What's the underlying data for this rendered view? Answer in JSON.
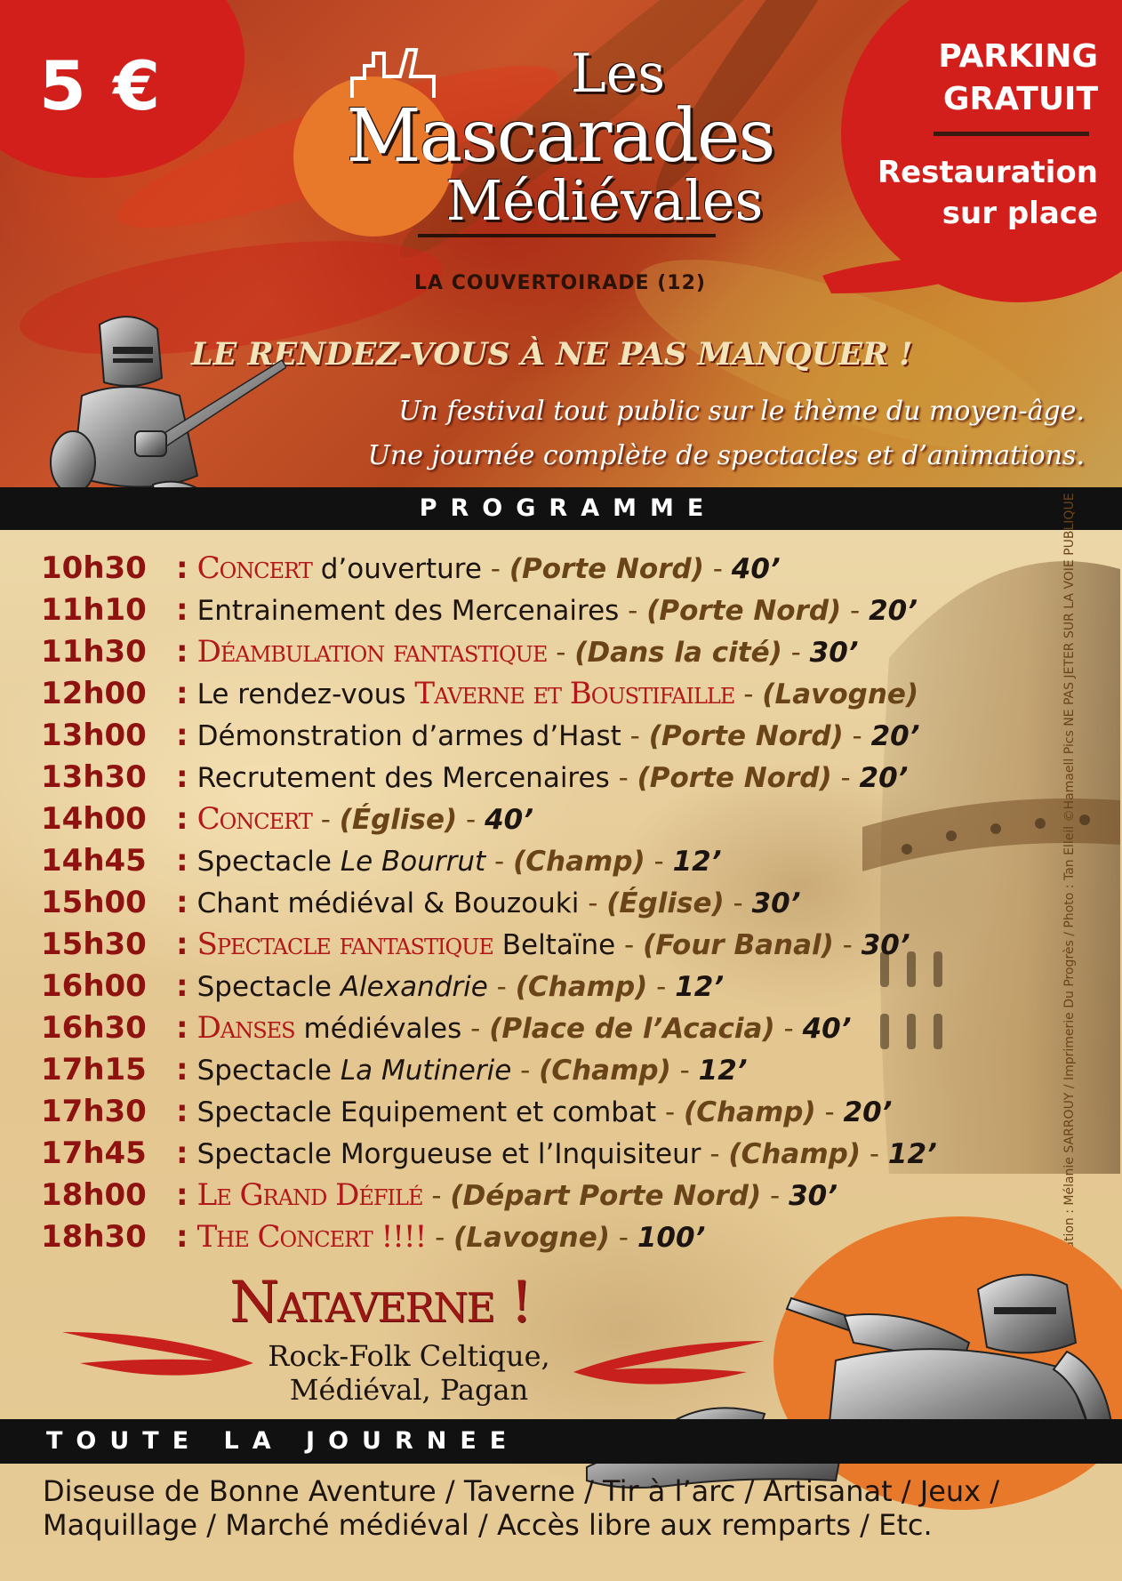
{
  "header": {
    "price": "5 €",
    "parking": "PARKING GRATUIT",
    "restauration": "Restauration sur place",
    "logo": {
      "line1": "Les",
      "line2": "Mascarades",
      "line3": "Médiévales"
    },
    "location": "LA COUVERTOIRADE (12)",
    "tagline": "LE RENDEZ-VOUS À NE PAS MANQUER !",
    "intro_line1": "Un festival tout public sur le thème du moyen-âge.",
    "intro_line2": "Une journée complète de spectacles et d’animations."
  },
  "programme": {
    "heading": "PROGRAMME",
    "items": [
      {
        "time": "10h30",
        "parts": [
          {
            "t": "hl",
            "v": "Concert"
          },
          {
            "t": "n",
            "v": " d’ouverture"
          },
          {
            "t": "sep",
            "v": " - "
          },
          {
            "t": "place",
            "v": "(Porte Nord)"
          },
          {
            "t": "sep",
            "v": " - "
          },
          {
            "t": "dur",
            "v": "40’"
          }
        ]
      },
      {
        "time": "11h10",
        "parts": [
          {
            "t": "n",
            "v": "Entrainement des Mercenaires"
          },
          {
            "t": "sep",
            "v": " - "
          },
          {
            "t": "place",
            "v": "(Porte Nord)"
          },
          {
            "t": "sep",
            "v": " - "
          },
          {
            "t": "dur",
            "v": "20’"
          }
        ]
      },
      {
        "time": "11h30",
        "parts": [
          {
            "t": "hl",
            "v": "Déambulation fantastique"
          },
          {
            "t": "sep",
            "v": " - "
          },
          {
            "t": "place",
            "v": "(Dans la cité)"
          },
          {
            "t": "sep",
            "v": " - "
          },
          {
            "t": "dur",
            "v": "30’"
          }
        ]
      },
      {
        "time": "12h00",
        "parts": [
          {
            "t": "n",
            "v": "Le rendez-vous "
          },
          {
            "t": "hl",
            "v": "Taverne et Boustifaille"
          },
          {
            "t": "sep",
            "v": " - "
          },
          {
            "t": "place",
            "v": "(Lavogne)"
          }
        ]
      },
      {
        "time": "13h00",
        "parts": [
          {
            "t": "n",
            "v": "Démonstration d’armes d’Hast"
          },
          {
            "t": "sep",
            "v": " - "
          },
          {
            "t": "place",
            "v": "(Porte Nord)"
          },
          {
            "t": "sep",
            "v": " - "
          },
          {
            "t": "dur",
            "v": "20’"
          }
        ]
      },
      {
        "time": "13h30",
        "parts": [
          {
            "t": "n",
            "v": "Recrutement des Mercenaires"
          },
          {
            "t": "sep",
            "v": " - "
          },
          {
            "t": "place",
            "v": "(Porte Nord)"
          },
          {
            "t": "sep",
            "v": " - "
          },
          {
            "t": "dur",
            "v": "20’"
          }
        ]
      },
      {
        "time": "14h00",
        "parts": [
          {
            "t": "hl",
            "v": "Concert"
          },
          {
            "t": "sep",
            "v": " - "
          },
          {
            "t": "place",
            "v": "(Église)"
          },
          {
            "t": "sep",
            "v": " - "
          },
          {
            "t": "dur",
            "v": "40’"
          }
        ]
      },
      {
        "time": "14h45",
        "parts": [
          {
            "t": "n",
            "v": "Spectacle "
          },
          {
            "t": "it",
            "v": "Le Bourrut"
          },
          {
            "t": "sep",
            "v": " - "
          },
          {
            "t": "place",
            "v": "(Champ)"
          },
          {
            "t": "sep",
            "v": " - "
          },
          {
            "t": "dur",
            "v": "12’"
          }
        ]
      },
      {
        "time": "15h00",
        "parts": [
          {
            "t": "n",
            "v": "Chant médiéval & Bouzouki"
          },
          {
            "t": "sep",
            "v": " - "
          },
          {
            "t": "place",
            "v": "(Église)"
          },
          {
            "t": "sep",
            "v": " - "
          },
          {
            "t": "dur",
            "v": "30’"
          }
        ]
      },
      {
        "time": "15h30",
        "parts": [
          {
            "t": "hl",
            "v": "Spectacle fantastique"
          },
          {
            "t": "n",
            "v": " Beltaïne"
          },
          {
            "t": "sep",
            "v": " - "
          },
          {
            "t": "place",
            "v": "(Four Banal)"
          },
          {
            "t": "sep",
            "v": " - "
          },
          {
            "t": "dur",
            "v": "30’"
          }
        ]
      },
      {
        "time": "16h00",
        "parts": [
          {
            "t": "n",
            "v": "Spectacle "
          },
          {
            "t": "it",
            "v": "Alexandrie"
          },
          {
            "t": "sep",
            "v": " - "
          },
          {
            "t": "place",
            "v": "(Champ)"
          },
          {
            "t": "sep",
            "v": " - "
          },
          {
            "t": "dur",
            "v": "12’"
          }
        ]
      },
      {
        "time": "16h30",
        "parts": [
          {
            "t": "hl",
            "v": "Danses"
          },
          {
            "t": "n",
            "v": " médiévales"
          },
          {
            "t": "sep",
            "v": " - "
          },
          {
            "t": "place",
            "v": "(Place de l’Acacia)"
          },
          {
            "t": "sep",
            "v": " - "
          },
          {
            "t": "dur",
            "v": "40’"
          }
        ]
      },
      {
        "time": "17h15",
        "parts": [
          {
            "t": "n",
            "v": "Spectacle "
          },
          {
            "t": "it",
            "v": "La Mutinerie"
          },
          {
            "t": "sep",
            "v": " - "
          },
          {
            "t": "place",
            "v": "(Champ)"
          },
          {
            "t": "sep",
            "v": " - "
          },
          {
            "t": "dur",
            "v": "12’"
          }
        ]
      },
      {
        "time": "17h30",
        "parts": [
          {
            "t": "n",
            "v": "Spectacle Equipement et combat"
          },
          {
            "t": "sep",
            "v": " - "
          },
          {
            "t": "place",
            "v": "(Champ)"
          },
          {
            "t": "sep",
            "v": " - "
          },
          {
            "t": "dur",
            "v": "20’"
          }
        ]
      },
      {
        "time": "17h45",
        "parts": [
          {
            "t": "n",
            "v": "Spectacle Morgueuse et l’Inquisiteur"
          },
          {
            "t": "sep",
            "v": " - "
          },
          {
            "t": "place",
            "v": "(Champ)"
          },
          {
            "t": "sep",
            "v": " - "
          },
          {
            "t": "dur",
            "v": "12’"
          }
        ]
      },
      {
        "time": "18h00",
        "parts": [
          {
            "t": "hl",
            "v": "Le Grand Défilé"
          },
          {
            "t": "sep",
            "v": " - "
          },
          {
            "t": "place",
            "v": "(Départ Porte Nord)"
          },
          {
            "t": "sep",
            "v": " - "
          },
          {
            "t": "dur",
            "v": "30’"
          }
        ]
      },
      {
        "time": "18h30",
        "parts": [
          {
            "t": "hl",
            "v": "The Concert !!!!"
          },
          {
            "t": "sep",
            "v": " - "
          },
          {
            "t": "place",
            "v": "(Lavogne)"
          },
          {
            "t": "sep",
            "v": " - "
          },
          {
            "t": "dur",
            "v": "100’"
          }
        ]
      }
    ]
  },
  "credits": "Réalisation : Mélanie SARROUY / Imprimerie Du Progrès / Photo : Tan Elleil ©Hamaell Pics    NE PAS JETER SUR LA VOIE PUBLIQUE",
  "band": {
    "name": "Nataverne !",
    "genre_line1": "Rock-Folk Celtique,",
    "genre_line2": "Médiéval, Pagan"
  },
  "journee": {
    "heading": "TOUTE LA JOURNEE",
    "line1": "Diseuse de Bonne Aventure / Taverne / Tir à l’arc / Artisanat / Jeux /",
    "line2": "Maquillage / Marché médiéval / Accès libre aux remparts / Etc."
  },
  "colors": {
    "red": "#d21f1b",
    "orange": "#e8792a",
    "dark_red": "#8e1210",
    "black_bar": "#111111"
  },
  "icons": [
    "castle-icon",
    "knight-with-sword",
    "helmet-photo",
    "reclining-knight"
  ]
}
